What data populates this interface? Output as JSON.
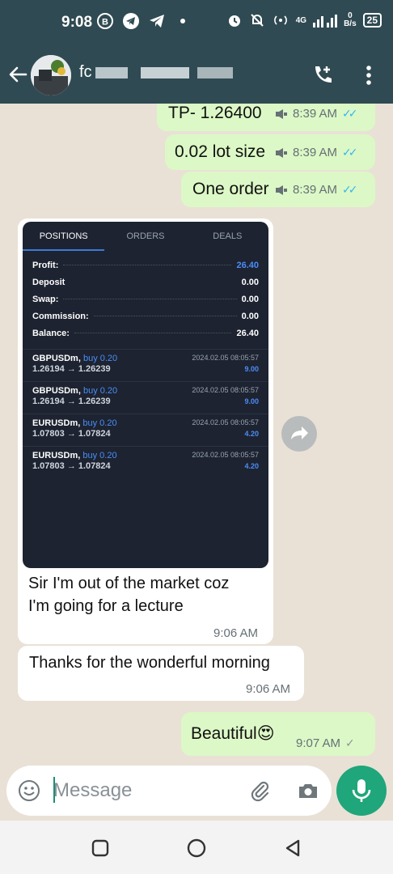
{
  "status_bar": {
    "time": "9:08",
    "network": "4G",
    "data_rate_value": "0",
    "data_rate_unit": "B/s",
    "battery": "25"
  },
  "header": {
    "contact_name_visible": "fc"
  },
  "messages": [
    {
      "text": "TP- 1.26400",
      "time": "8:39 AM"
    },
    {
      "text": "0.02 lot size",
      "time": "8:39 AM"
    },
    {
      "text": "One order",
      "time": "8:39 AM"
    }
  ],
  "screenshot": {
    "tabs": [
      "POSITIONS",
      "ORDERS",
      "DEALS"
    ],
    "summary": [
      {
        "label": "Profit:",
        "value": "26.40"
      },
      {
        "label": "Deposit",
        "value": "0.00"
      },
      {
        "label": "Swap:",
        "value": "0.00"
      },
      {
        "label": "Commission:",
        "value": "0.00"
      },
      {
        "label": "Balance:",
        "value": "26.40"
      }
    ],
    "positions": [
      {
        "symbol": "GBPUSDm,",
        "side": "buy 0.20",
        "prices": "1.26194 → 1.26239",
        "date": "2024.02.05 08:05:57",
        "profit": "9.00"
      },
      {
        "symbol": "GBPUSDm,",
        "side": "buy 0.20",
        "prices": "1.26194 → 1.26239",
        "date": "2024.02.05 08:05:57",
        "profit": "9.00"
      },
      {
        "symbol": "EURUSDm,",
        "side": "buy 0.20",
        "prices": "1.07803 → 1.07824",
        "date": "2024.02.05 08:05:57",
        "profit": "4.20"
      },
      {
        "symbol": "EURUSDm,",
        "side": "buy 0.20",
        "prices": "1.07803 → 1.07824",
        "date": "2024.02.05 08:05:57",
        "profit": "4.20"
      }
    ]
  },
  "incoming": [
    {
      "text_line1": "Sir I'm out of the market coz",
      "text_line2": "I'm going for a lecture",
      "time": "9:06 AM"
    },
    {
      "text": "Thanks for the wonderful morning",
      "time": "9:06 AM"
    }
  ],
  "last_out": {
    "text": "Beautiful",
    "emoji": "😍",
    "time": "9:07 AM"
  },
  "input": {
    "placeholder": "Message"
  },
  "colors": {
    "header": "#2f4a52",
    "outgoing": "#dcf8c6",
    "accent": "#1fa67a",
    "read_ticks": "#34b7f1"
  }
}
